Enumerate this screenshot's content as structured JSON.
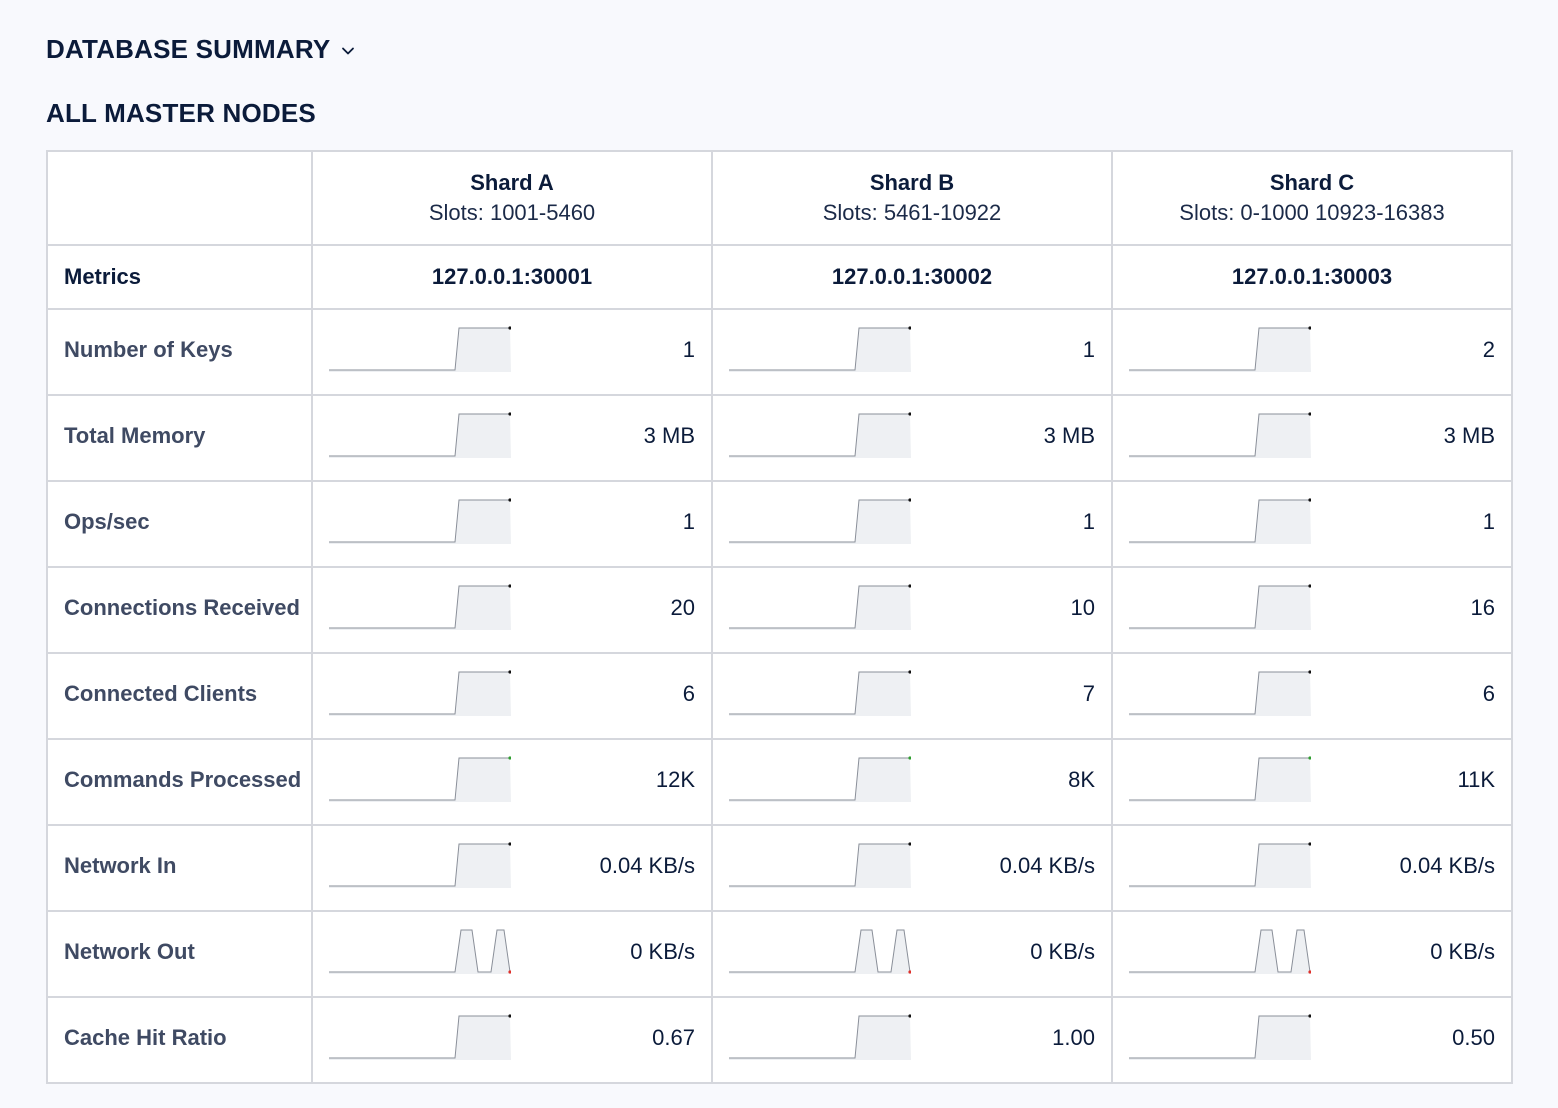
{
  "summary": {
    "title": "DATABASE SUMMARY"
  },
  "section": {
    "title": "ALL MASTER NODES"
  },
  "shards": [
    {
      "name": "Shard A",
      "slots": "Slots: 1001-5460",
      "address": "127.0.0.1:30001"
    },
    {
      "name": "Shard B",
      "slots": "Slots: 5461-10922",
      "address": "127.0.0.1:30002"
    },
    {
      "name": "Shard C",
      "slots": "Slots: 0-1000 10923-16383",
      "address": "127.0.0.1:30003"
    }
  ],
  "metrics_label": "Metrics",
  "metrics": [
    {
      "label": "Number of Keys",
      "values": [
        "1",
        "1",
        "2"
      ],
      "spark": "step",
      "dot_color": "#111111"
    },
    {
      "label": "Total Memory",
      "values": [
        "3 MB",
        "3 MB",
        "3 MB"
      ],
      "spark": "step",
      "dot_color": "#111111"
    },
    {
      "label": "Ops/sec",
      "values": [
        "1",
        "1",
        "1"
      ],
      "spark": "step",
      "dot_color": "#111111"
    },
    {
      "label": "Connections Received",
      "values": [
        "20",
        "10",
        "16"
      ],
      "spark": "step",
      "dot_color": "#111111"
    },
    {
      "label": "Connected Clients",
      "values": [
        "6",
        "7",
        "6"
      ],
      "spark": "step",
      "dot_color": "#111111"
    },
    {
      "label": "Commands Processed",
      "values": [
        "12K",
        "8K",
        "11K"
      ],
      "spark": "step",
      "dot_color": "#2e9d2e"
    },
    {
      "label": "Network In",
      "values": [
        "0.04 KB/s",
        "0.04 KB/s",
        "0.04 KB/s"
      ],
      "spark": "step",
      "dot_color": "#111111"
    },
    {
      "label": "Network Out",
      "values": [
        "0 KB/s",
        "0 KB/s",
        "0 KB/s"
      ],
      "spark": "double-peak",
      "dot_color": "#e0302a"
    },
    {
      "label": "Cache Hit Ratio",
      "values": [
        "0.67",
        "1.00",
        "0.50"
      ],
      "spark": "step",
      "dot_color": "#111111"
    }
  ],
  "colors": {
    "spark_line": "#8a8f99",
    "spark_fill": "#eef0f3",
    "border": "#d5d7dd",
    "text": "#0b1b3a"
  }
}
